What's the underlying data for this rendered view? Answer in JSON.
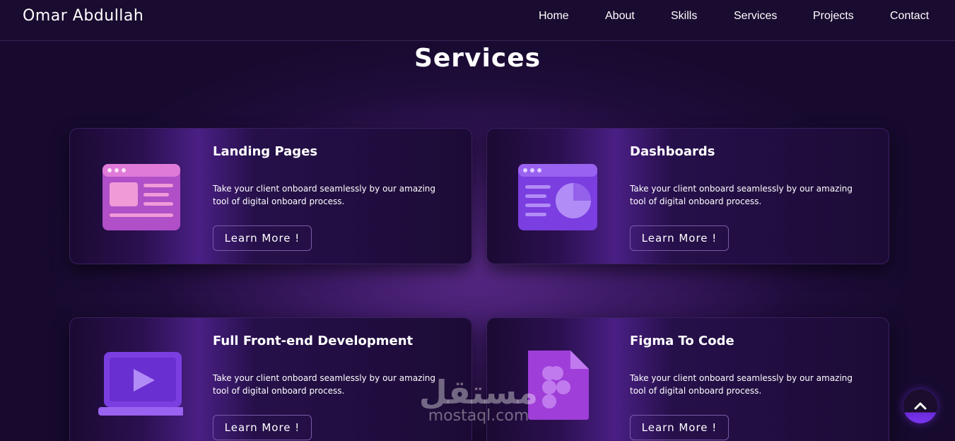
{
  "header": {
    "brand": "Omar Abdullah",
    "nav": [
      {
        "label": "Home"
      },
      {
        "label": "About"
      },
      {
        "label": "Skills"
      },
      {
        "label": "Services"
      },
      {
        "label": "Projects"
      },
      {
        "label": "Contact"
      }
    ]
  },
  "services": {
    "title": "Services",
    "cards": [
      {
        "title": "Landing Pages",
        "description": "Take your client onboard seamlessly by our amazing tool of digital onboard process.",
        "button": "Learn More !",
        "icon": "landing-page-icon"
      },
      {
        "title": "Dashboards",
        "description": "Take your client onboard seamlessly by our amazing tool of digital onboard process.",
        "button": "Learn More !",
        "icon": "dashboard-icon"
      },
      {
        "title": "Full Front-end Development",
        "description": "Take your client onboard seamlessly by our amazing tool of digital onboard process.",
        "button": "Learn More !",
        "icon": "laptop-play-icon"
      },
      {
        "title": "Figma To Code",
        "description": "Take your client onboard seamlessly by our amazing tool of digital onboard process.",
        "button": "Learn More !",
        "icon": "figma-file-icon"
      }
    ]
  },
  "watermark": {
    "arabic": "مستقل",
    "latin": "mostaql.com"
  },
  "scroll_top": {
    "icon": "chevron-up-icon"
  },
  "colors": {
    "background": "#1e0c3a",
    "accent": "#7b35f0",
    "card": "#2b1050"
  }
}
